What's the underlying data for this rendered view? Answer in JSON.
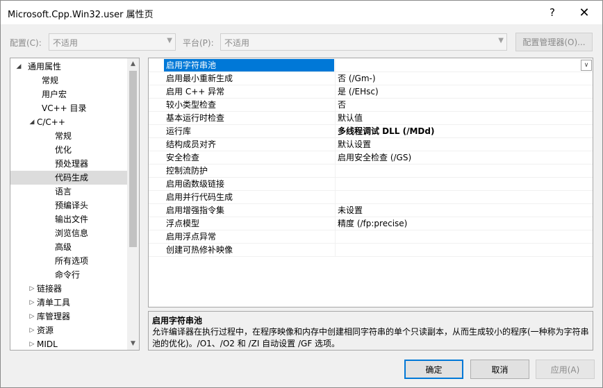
{
  "window": {
    "title": "Microsoft.Cpp.Win32.user 属性页",
    "help_glyph": "?",
    "close_glyph": "✕"
  },
  "toolbar": {
    "config_label": "配置(C):",
    "config_value": "不适用",
    "platform_label": "平台(P):",
    "platform_value": "不适用",
    "config_manager_label": "配置管理器(O)..."
  },
  "tree": {
    "items": [
      {
        "label": "通用属性",
        "toggle": "◢"
      },
      {
        "label": "常规",
        "toggle": ""
      },
      {
        "label": "用户宏",
        "toggle": ""
      },
      {
        "label": "VC++ 目录",
        "toggle": ""
      },
      {
        "label": "C/C++",
        "toggle": "◢"
      },
      {
        "label": "常规",
        "toggle": ""
      },
      {
        "label": "优化",
        "toggle": ""
      },
      {
        "label": "预处理器",
        "toggle": ""
      },
      {
        "label": "代码生成",
        "toggle": ""
      },
      {
        "label": "语言",
        "toggle": ""
      },
      {
        "label": "预编译头",
        "toggle": ""
      },
      {
        "label": "输出文件",
        "toggle": ""
      },
      {
        "label": "浏览信息",
        "toggle": ""
      },
      {
        "label": "高级",
        "toggle": ""
      },
      {
        "label": "所有选项",
        "toggle": ""
      },
      {
        "label": "命令行",
        "toggle": ""
      },
      {
        "label": "链接器",
        "toggle": "▷"
      },
      {
        "label": "清单工具",
        "toggle": "▷"
      },
      {
        "label": "库管理器",
        "toggle": "▷"
      },
      {
        "label": "资源",
        "toggle": "▷"
      },
      {
        "label": "MIDL",
        "toggle": "▷"
      }
    ],
    "selected_index": 8
  },
  "properties": {
    "rows": [
      {
        "name": "启用字符串池",
        "value": ""
      },
      {
        "name": "启用最小重新生成",
        "value": "否 (/Gm-)"
      },
      {
        "name": "启用 C++ 异常",
        "value": "是 (/EHsc)"
      },
      {
        "name": "较小类型检查",
        "value": "否"
      },
      {
        "name": "基本运行时检查",
        "value": "默认值"
      },
      {
        "name": "运行库",
        "value": "多线程调试 DLL (/MDd)"
      },
      {
        "name": "结构成员对齐",
        "value": "默认设置"
      },
      {
        "name": "安全检查",
        "value": "启用安全检查 (/GS)"
      },
      {
        "name": "控制流防护",
        "value": ""
      },
      {
        "name": "启用函数级链接",
        "value": ""
      },
      {
        "name": "启用并行代码生成",
        "value": ""
      },
      {
        "name": "启用增强指令集",
        "value": "未设置"
      },
      {
        "name": "浮点模型",
        "value": "精度 (/fp:precise)"
      },
      {
        "name": "启用浮点异常",
        "value": ""
      },
      {
        "name": "创建可热修补映像",
        "value": ""
      }
    ]
  },
  "description": {
    "title": "启用字符串池",
    "body": "允许编译器在执行过程中，在程序映像和内存中创建相同字符串的单个只读副本，从而生成较小的程序(一种称为字符串池的优化)。/O1、/O2 和 /ZI 自动设置 /GF 选项。"
  },
  "buttons": {
    "ok": "确定",
    "cancel": "取消",
    "apply": "应用(A)"
  },
  "colors": {
    "selection_blue": "#0078d7",
    "tree_selection": "#dcdcdc"
  }
}
